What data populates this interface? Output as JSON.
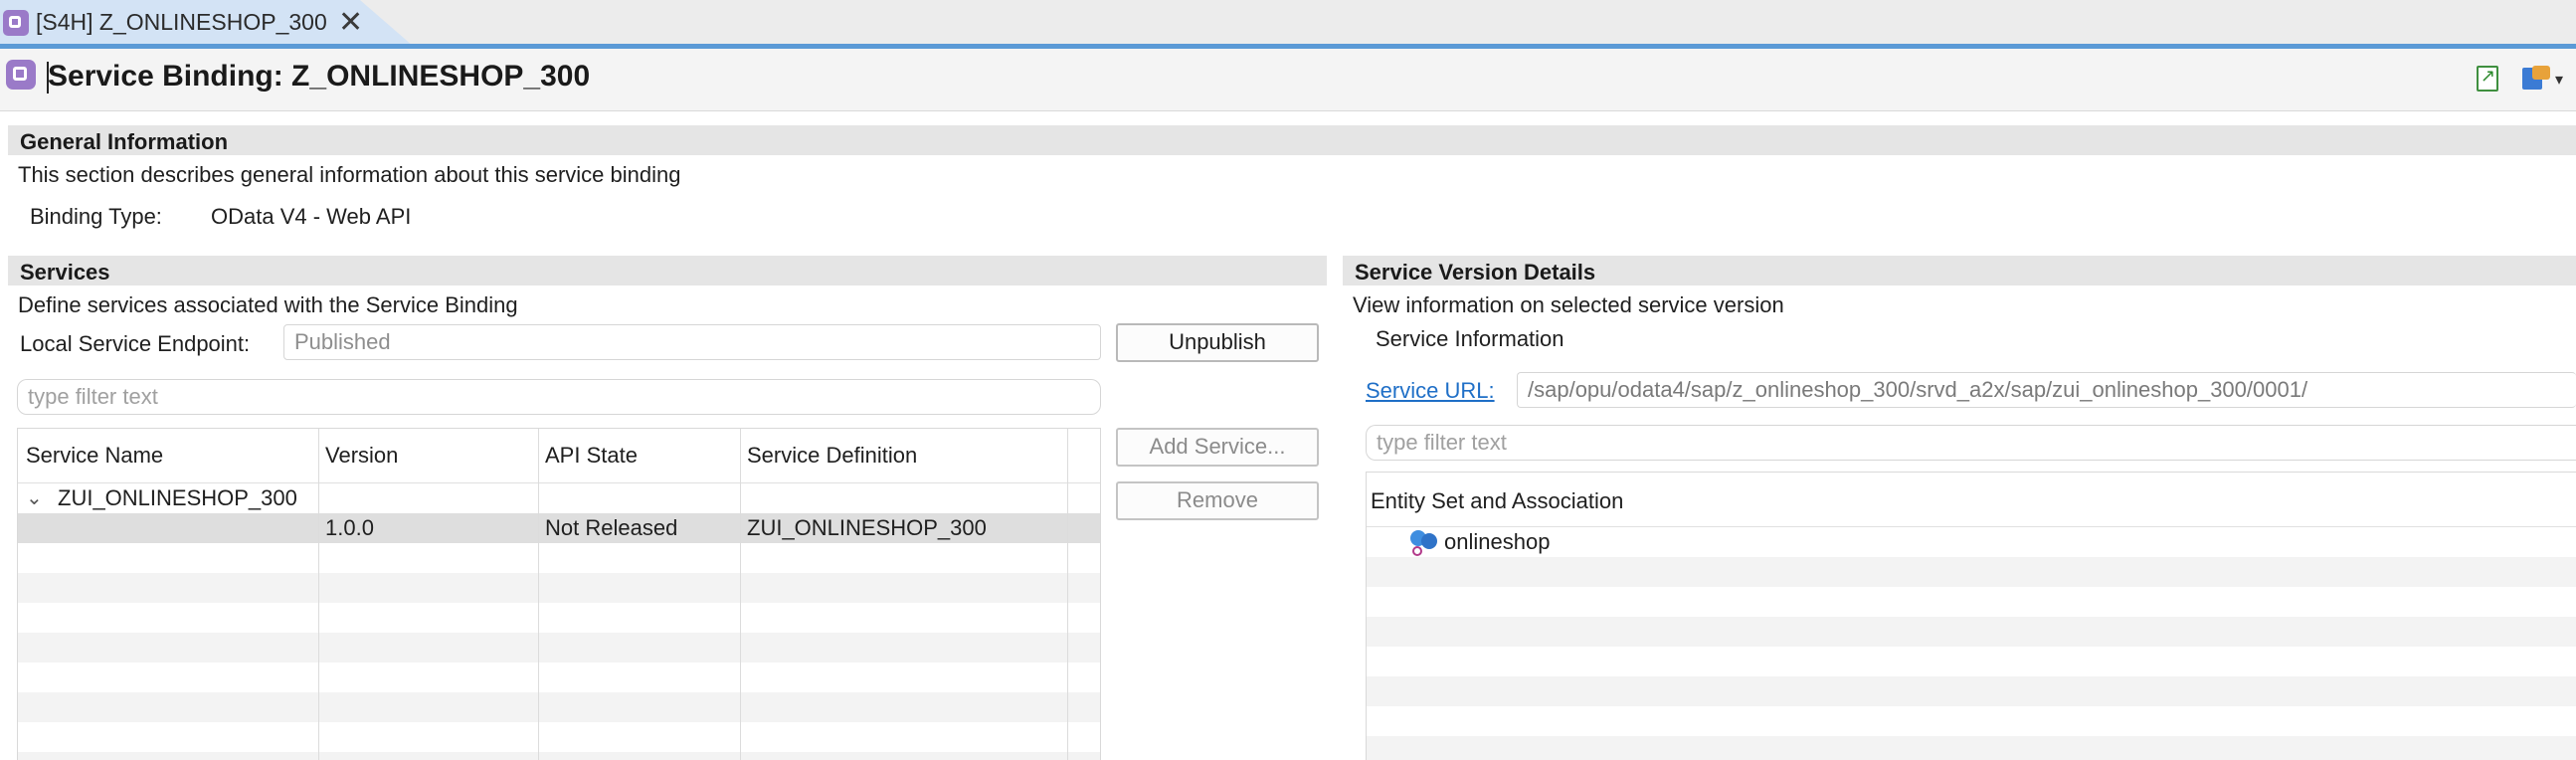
{
  "tab": {
    "label": "[S4H] Z_ONLINESHOP_300",
    "close": "✕"
  },
  "editor": {
    "title": "Service Binding: Z_ONLINESHOP_300"
  },
  "general": {
    "heading": "General Information",
    "description": "This section describes general information about this service binding",
    "binding_type_label": "Binding Type:",
    "binding_type_value": "OData V4 - Web API"
  },
  "services": {
    "heading": "Services",
    "description": "Define services associated with the Service Binding",
    "endpoint_label": "Local Service Endpoint:",
    "endpoint_value": "Published",
    "unpublish_button": "Unpublish",
    "filter_placeholder": "type filter text",
    "add_button": "Add Service...",
    "remove_button": "Remove",
    "columns": [
      "Service Name",
      "Version",
      "API State",
      "Service Definition"
    ],
    "group": {
      "name": "ZUI_ONLINESHOP_300",
      "expander": "⌄"
    },
    "rows": [
      {
        "name": "",
        "version": "1.0.0",
        "api_state": "Not Released",
        "definition": "ZUI_ONLINESHOP_300"
      }
    ]
  },
  "details": {
    "heading": "Service Version Details",
    "description": "View information on selected service version",
    "service_info_label": "Service Information",
    "url_label": "Service URL:",
    "url_value": "/sap/opu/odata4/sap/z_onlineshop_300/srvd_a2x/sap/zui_onlineshop_300/0001/",
    "filter_placeholder": "type filter text",
    "tree_heading": "Entity Set and Association",
    "entities": [
      "onlineshop"
    ]
  },
  "icons": {
    "tab": "service-binding-icon",
    "title": "service-binding-icon",
    "toolbar": [
      "refresh-icon",
      "settings-icon"
    ],
    "entity": "entity-set-icon"
  },
  "colors": {
    "tab_active": "#d3e3f5",
    "tab_underline": "#5b9ad6",
    "link": "#1f6fc7",
    "section_header": "#e5e5e5",
    "selected_row": "#dedede"
  }
}
